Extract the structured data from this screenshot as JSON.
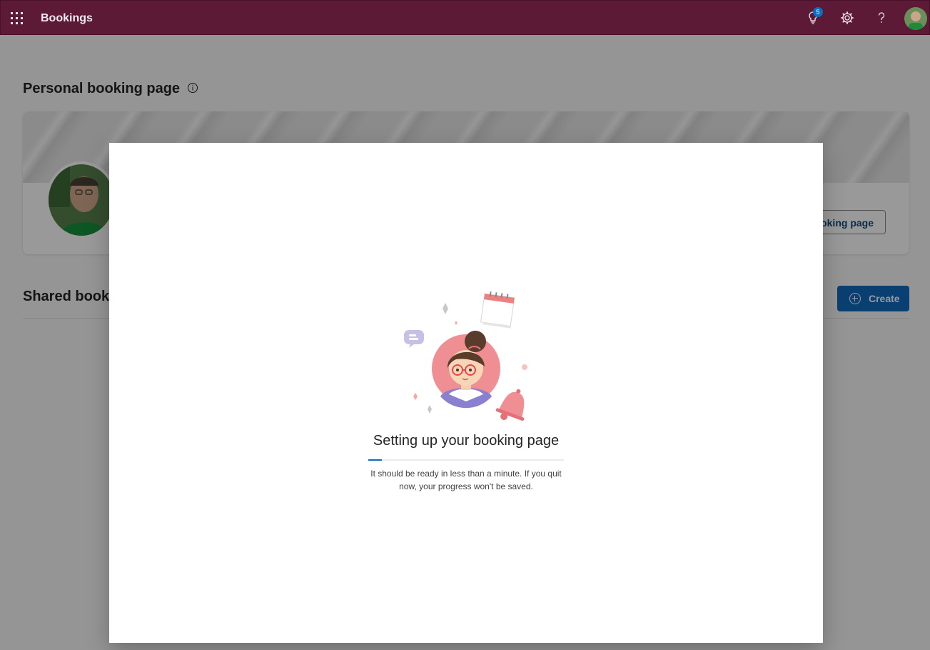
{
  "header": {
    "app_name": "Bookings",
    "notification_count": "5",
    "icons": [
      "app-launcher-icon",
      "lightbulb-icon",
      "gear-icon",
      "help-icon",
      "user-avatar"
    ],
    "background": "#5c1a36"
  },
  "personal": {
    "title": "Personal booking page",
    "button_label": "oking page"
  },
  "shared": {
    "title": "Shared booki",
    "create_label": "Create"
  },
  "dialog": {
    "title": "Setting up your booking page",
    "description": "It should be ready in less than a minute. If you quit now, your progress won't be saved.",
    "progress": 0.07
  },
  "colors": {
    "accent": "#0f6cbd",
    "header": "#5c1a36"
  }
}
